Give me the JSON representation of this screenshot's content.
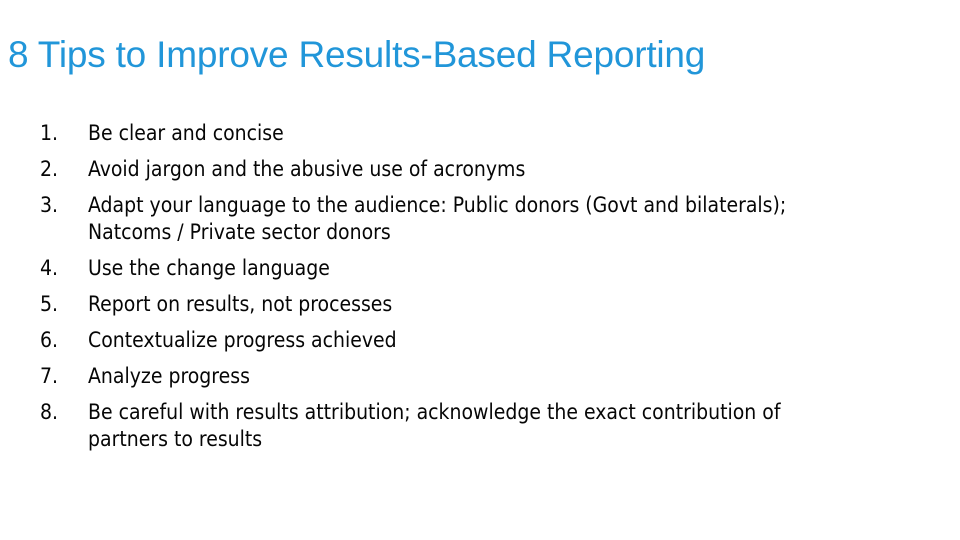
{
  "slide": {
    "title": "8 Tips to Improve Results-Based Reporting",
    "title_color": "#2196d9",
    "body_color": "#060606",
    "background_color": "#ffffff",
    "list_style": "decimal",
    "items": [
      {
        "number": "1.",
        "text": "Be clear and concise"
      },
      {
        "number": "2.",
        "text": "Avoid jargon and the abusive use of acronyms"
      },
      {
        "number": "3.",
        "text": "Adapt your language to the audience: Public donors (Govt and bilaterals); Natcoms / Private sector donors"
      },
      {
        "number": "4.",
        "text": "Use the change language"
      },
      {
        "number": "5.",
        "text": "Report on results, not processes"
      },
      {
        "number": "6.",
        "text": "Contextualize progress achieved"
      },
      {
        "number": "7.",
        "text": "Analyze progress"
      },
      {
        "number": "8.",
        "text": "Be careful with results attribution; acknowledge the exact contribution of partners to results"
      }
    ]
  }
}
